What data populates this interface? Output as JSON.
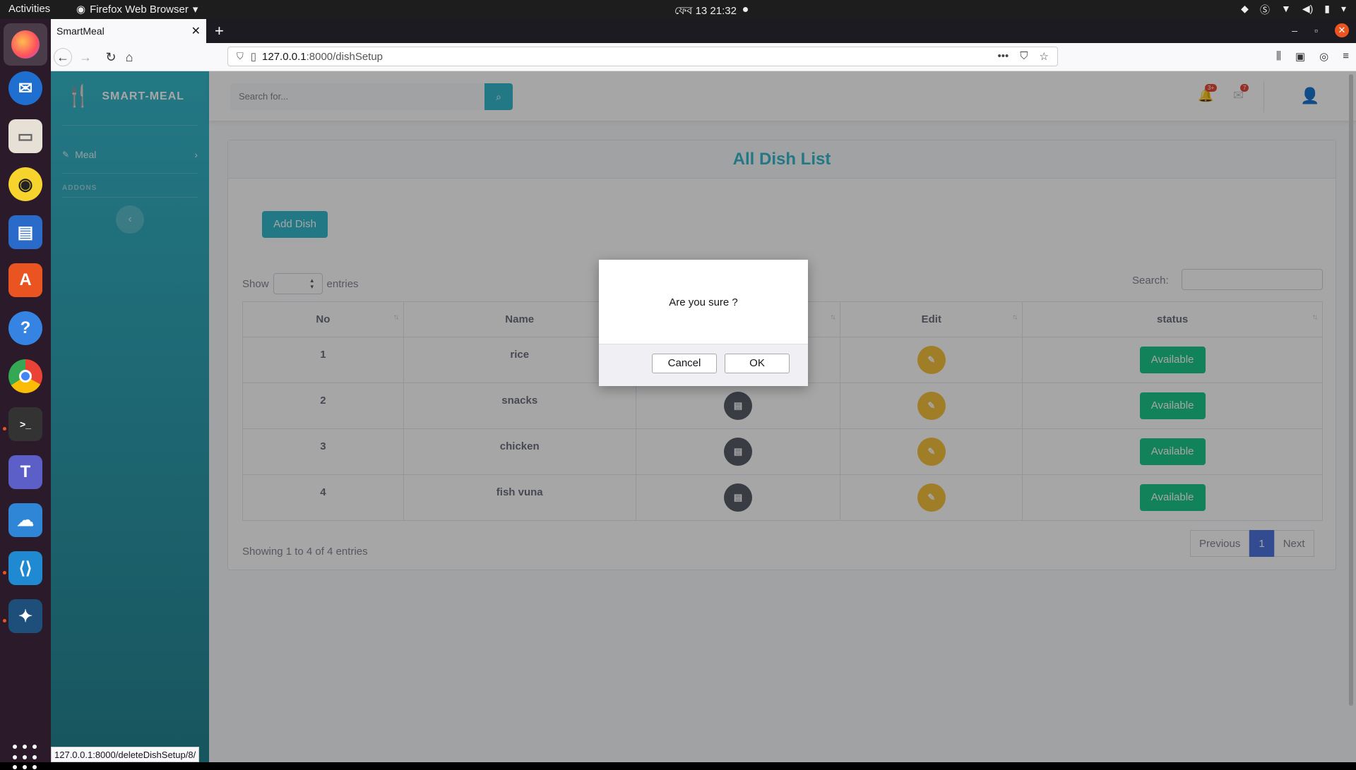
{
  "system": {
    "activities": "Activities",
    "app_name": "Firefox Web Browser",
    "clock": "ফেব 13  21:32"
  },
  "browser": {
    "tab_title": "SmartMeal",
    "url_host": "127.0.0.1",
    "url_path": ":8000/dishSetup",
    "status_url": "127.0.0.1:8000/deleteDishSetup/8/"
  },
  "sidebar": {
    "brand": "SMART-MEAL",
    "items": [
      {
        "label": "Meal"
      }
    ],
    "section_heading": "ADDONS"
  },
  "topnav": {
    "search_placeholder": "Search for...",
    "alerts_badge": "3+",
    "messages_badge": "7"
  },
  "card": {
    "title": "All Dish List",
    "add_button": "Add Dish",
    "show_label": "Show",
    "entries_label": "entries",
    "search_label": "Search:",
    "columns": [
      "No",
      "Name",
      "",
      "Edit",
      "status"
    ],
    "rows": [
      {
        "no": "1",
        "name": "rice",
        "status": "Available"
      },
      {
        "no": "2",
        "name": "snacks",
        "status": "Available"
      },
      {
        "no": "3",
        "name": "chicken",
        "status": "Available"
      },
      {
        "no": "4",
        "name": "fish vuna",
        "status": "Available"
      }
    ],
    "showing": "Showing 1 to 4 of 4 entries",
    "pager": {
      "previous": "Previous",
      "current": "1",
      "next": "Next"
    }
  },
  "dialog": {
    "message": "Are you sure ?",
    "cancel": "Cancel",
    "ok": "OK"
  },
  "colors": {
    "sidebar_top": "#36b9cc",
    "sidebar_bottom": "#258391",
    "success": "#1cc88a",
    "warning": "#f6c23e",
    "primary": "#4e73df"
  }
}
